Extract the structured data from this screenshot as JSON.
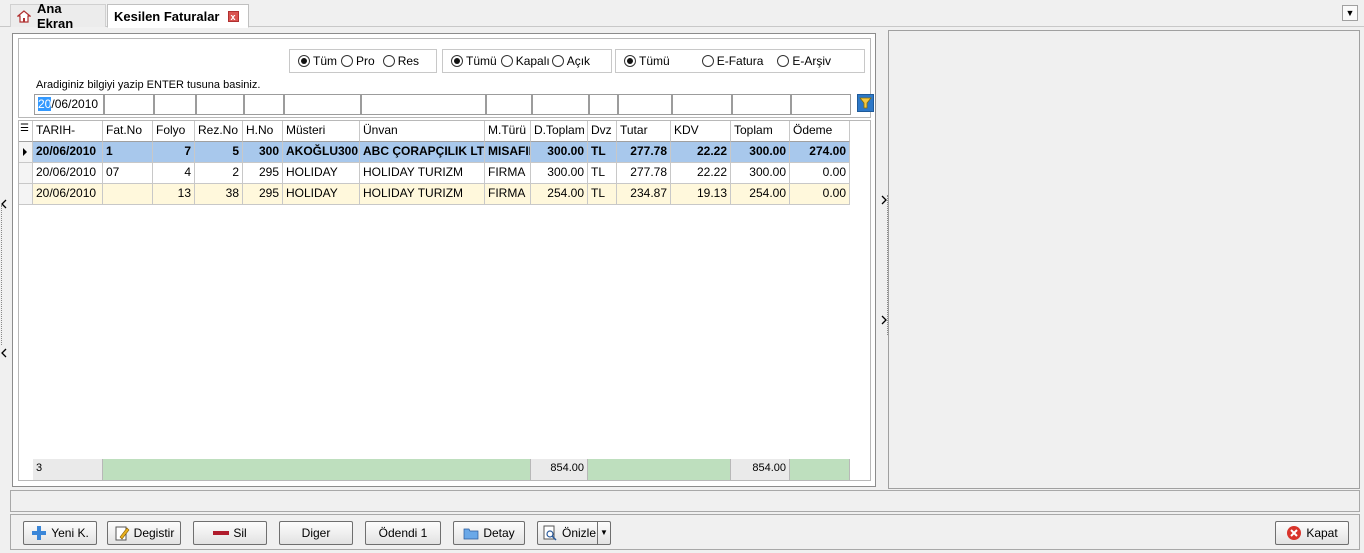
{
  "tabs": [
    {
      "label": "Ana Ekran"
    },
    {
      "label": "Kesilen Faturalar",
      "close": "x"
    }
  ],
  "filters": {
    "group1": [
      "Tüm",
      "Pro",
      "Res"
    ],
    "group2": [
      "Tümü",
      "Kapalı",
      "Açık"
    ],
    "group3": [
      "Tümü",
      "E-Fatura",
      "E-Arşiv"
    ],
    "hint": "Aradiginiz bilgiyi yazip ENTER tusuna basiniz.",
    "date_selected": "20",
    "date_rest": "/06/2010"
  },
  "grid": {
    "columns": [
      "TARIH-",
      "Fat.No",
      "Folyo",
      "Rez.No",
      "H.No",
      "Müsteri",
      "Ünvan",
      "M.Türü",
      "D.Toplam",
      "Dvz",
      "Tutar",
      "KDV",
      "Toplam",
      "Ödeme"
    ],
    "rows": [
      [
        "20/06/2010",
        "1",
        "7",
        "5",
        "300",
        "AKOĞLU300",
        "ABC ÇORAPÇILIK LTD",
        "MISAFIR",
        "300.00",
        "TL",
        "277.78",
        "22.22",
        "300.00",
        "274.00"
      ],
      [
        "20/06/2010",
        "07",
        "4",
        "2",
        "295",
        "HOLIDAY",
        "HOLIDAY TURIZM",
        "FIRMA",
        "300.00",
        "TL",
        "277.78",
        "22.22",
        "300.00",
        "0.00"
      ],
      [
        "20/06/2010",
        "",
        "13",
        "38",
        "295",
        "HOLIDAY",
        "HOLIDAY TURIZM",
        "FIRMA",
        "254.00",
        "TL",
        "234.87",
        "19.13",
        "254.00",
        "0.00"
      ]
    ],
    "footer": {
      "count": "3",
      "d_toplam": "854.00",
      "toplam": "854.00"
    }
  },
  "toolbar": {
    "yeni": "Yeni K.",
    "degistir": "Degistir",
    "sil": "Sil",
    "diger": "Diger",
    "odendi": "Ödendi 1",
    "detay": "Detay",
    "onizle": "Önizle",
    "kapat": "Kapat"
  }
}
